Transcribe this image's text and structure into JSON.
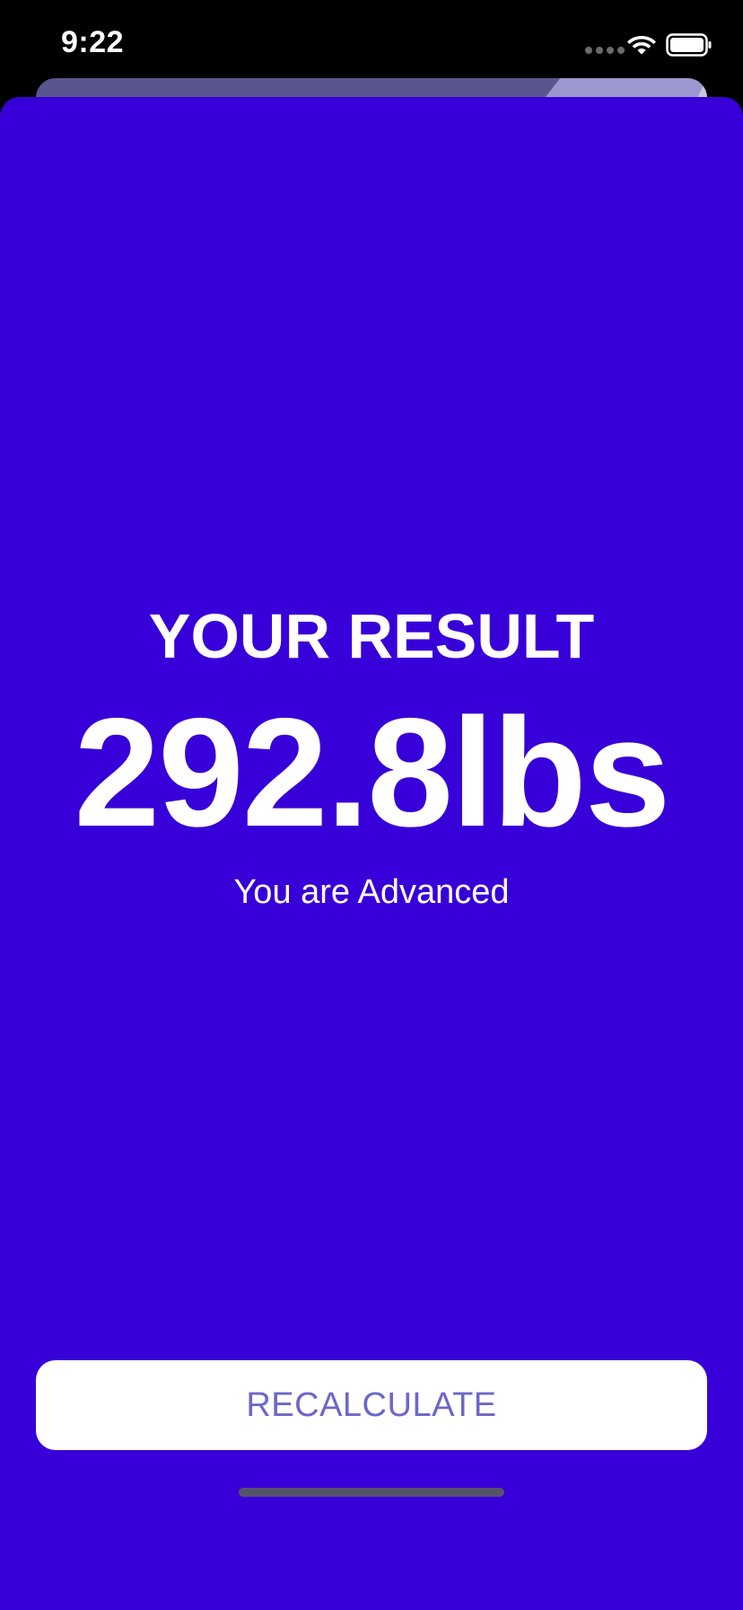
{
  "status_bar": {
    "time": "9:22",
    "icons": [
      "cellular-dots-icon",
      "wifi-icon",
      "battery-icon"
    ]
  },
  "result": {
    "title": "YOUR RESULT",
    "value": "292.8lbs",
    "level": "You are Advanced"
  },
  "actions": {
    "recalculate_label": "RECALCULATE"
  },
  "colors": {
    "sheet_background": "#3800d8",
    "button_text": "#6c67c8",
    "button_background": "#ffffff",
    "text": "#ffffff"
  }
}
